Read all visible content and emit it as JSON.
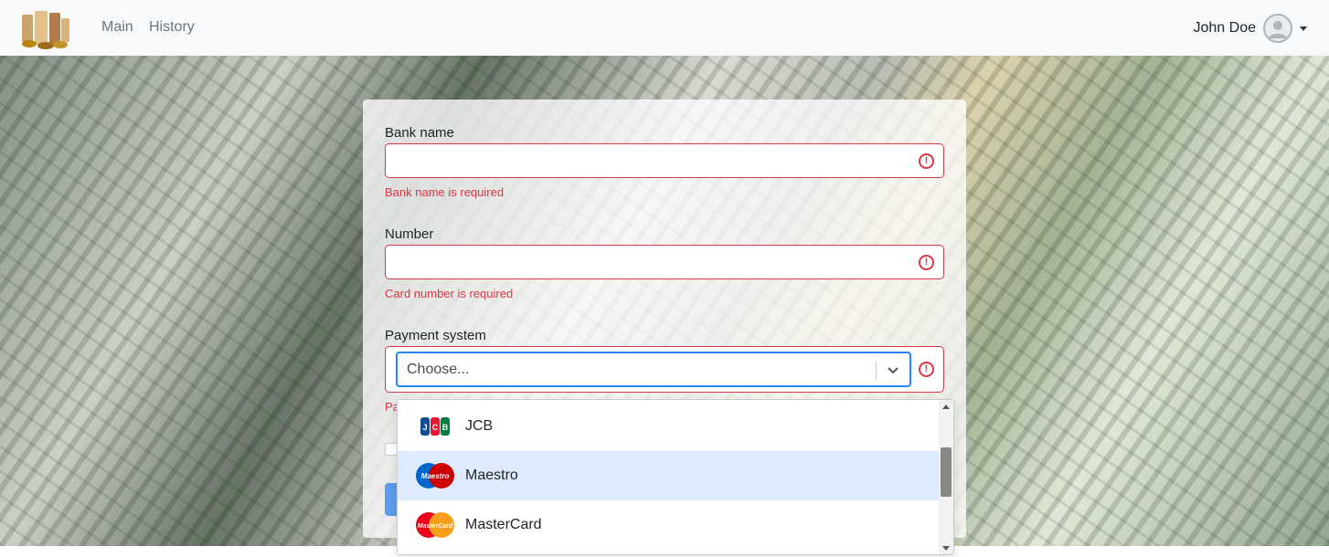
{
  "nav": {
    "links": [
      "Main",
      "History"
    ],
    "user_name": "John Doe"
  },
  "form": {
    "bank_name": {
      "label": "Bank name",
      "value": "",
      "error": "Bank name is required"
    },
    "number": {
      "label": "Number",
      "value": "",
      "error": "Card number is required"
    },
    "payment_system": {
      "label": "Payment system",
      "placeholder": "Choose...",
      "error_partial": "Pa"
    }
  },
  "dropdown": {
    "options": [
      {
        "label": "JCB",
        "icon": "jcb-logo-icon"
      },
      {
        "label": "Maestro",
        "icon": "maestro-logo-icon",
        "highlighted": true
      },
      {
        "label": "MasterCard",
        "icon": "mastercard-logo-icon"
      }
    ]
  },
  "colors": {
    "error": "#dc3545",
    "focus": "#2684ff",
    "highlight": "#deebff",
    "navbar": "#f8f9fa"
  }
}
